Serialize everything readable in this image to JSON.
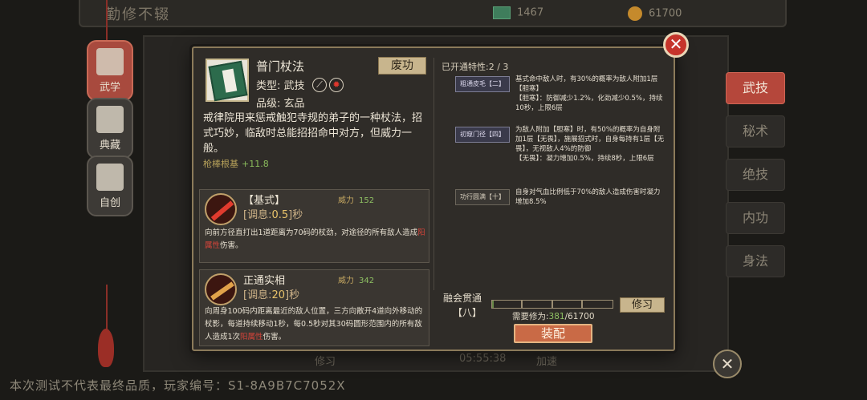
{
  "top_bar": {
    "title": "勤修不辍",
    "resource_1": "1467",
    "resource_2": "61700"
  },
  "left_tabs": [
    {
      "label": "武学",
      "active": true
    },
    {
      "label": "典藏",
      "active": false
    },
    {
      "label": "自创",
      "active": false
    }
  ],
  "right_tabs": [
    {
      "label": "武技",
      "active": true
    },
    {
      "label": "秘术",
      "active": false
    },
    {
      "label": "绝技",
      "active": false
    },
    {
      "label": "内功",
      "active": false
    },
    {
      "label": "身法",
      "active": false
    }
  ],
  "skill": {
    "name": "普门杖法",
    "type_label": "类型:",
    "type_value": "武技",
    "grade_label": "品级:",
    "grade_value": "玄品",
    "abolish_label": "废功",
    "description": "戒律院用来惩戒触犯寺规的弟子的一种杖法，招式巧妙，临敌时总能招招命中对方，但威力一般。",
    "stat_name": "枪棒根基",
    "stat_value": "+11.8"
  },
  "moves": [
    {
      "name": "【基式】",
      "cd_prefix": "[调息:",
      "cd_value": "0.5",
      "cd_suffix": "]秒",
      "power_label": "威力",
      "power_value": "152",
      "desc_pre": "向前方径直打出1道距离为70码的杖劲，对途径的所有敌人造成",
      "desc_hl": "阳属性",
      "desc_post": "伤害。"
    },
    {
      "name": "正通实相",
      "cd_prefix": "[调息:",
      "cd_value": "20",
      "cd_suffix": "]秒",
      "power_label": "威力",
      "power_value": "342",
      "desc_pre": "向周身100码内距离最近的敌人位置，三方向散开4道向外移动的杖影，每道持续移动1秒，每0.5秒对其30码圆形范围内的所有敌人造成1次",
      "desc_hl": "阳属性",
      "desc_post": "伤害。"
    }
  ],
  "traits": {
    "header": "已开通特性:2 / 3",
    "items": [
      {
        "tag": "粗通皮毛【二】",
        "style": "blue",
        "text": "基式命中敌人时，有30%的概率为敌人附加1层【胆寒】\n【胆寒】：防御减少1.2%，化劲减少0.5%，持续10秒，上限6层"
      },
      {
        "tag": "初窥门径【四】",
        "style": "blue",
        "text": "为敌人附加【胆寒】时，有50%的概率为自身附加1层【无畏】，施展招式时，自身每持有1层【无畏】，无视敌人4%的防御\n【无畏】：凝力增加0.5%，持续8秒，上限6层"
      },
      {
        "tag": "功行圆满【十】",
        "style": "plain",
        "text": "自身对气血比例低于70%的敌人造成伤害时凝力增加8.5%"
      }
    ]
  },
  "fusion": {
    "label": "融会贯通",
    "level": "【八】",
    "progress_fraction": 0.0062,
    "need_label": "需要修为:",
    "need_current": "381",
    "need_total": "/61700",
    "repair_label": "修习",
    "equip_label": "装配"
  },
  "bottom_bg": {
    "text_1": "修习",
    "text_2": "05:55:38",
    "text_3": "加速"
  },
  "footer_note": "本次测试不代表最终品质，玩家编号：S1-8A9B7C7052X"
}
